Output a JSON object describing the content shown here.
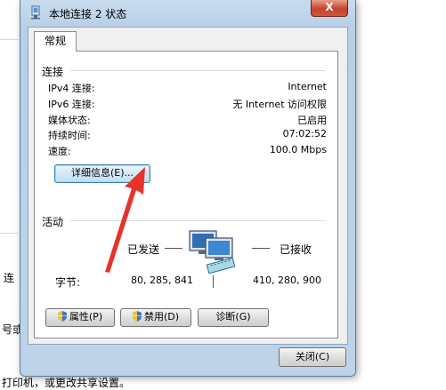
{
  "background": {
    "fragment_1": "连",
    "fragment_2": "号或",
    "fragment_3": "打印机，或更改共享设置。"
  },
  "window": {
    "title": "本地连接 2 状态",
    "close_glyph": "X",
    "tab": "常规",
    "connection": {
      "section": "连接",
      "rows": [
        {
          "label": "IPv4 连接:",
          "value": "Internet"
        },
        {
          "label": "IPv6 连接:",
          "value": "无 Internet 访问权限"
        },
        {
          "label": "媒体状态:",
          "value": "已启用"
        },
        {
          "label": "持续时间:",
          "value": "07:02:52"
        },
        {
          "label": "速度:",
          "value": "100.0 Mbps"
        }
      ],
      "details_button": "详细信息(E)..."
    },
    "activity": {
      "section": "活动",
      "sent_label": "已发送",
      "received_label": "已接收",
      "bytes_label": "字节:",
      "bytes_sent": "80, 285, 841",
      "bytes_received": "410, 280, 900"
    },
    "buttons": {
      "properties": "属性(P)",
      "disable": "禁用(D)",
      "diagnose": "诊断(G)",
      "close": "关闭(C)"
    }
  },
  "colors": {
    "arrow": "#e8332a",
    "window_frame": "#bfd3e8",
    "close_button": "#c7432b"
  }
}
